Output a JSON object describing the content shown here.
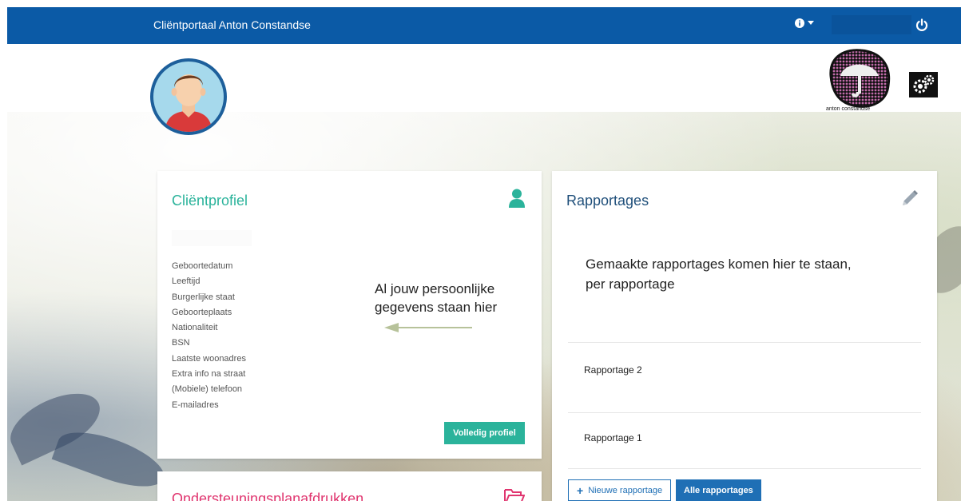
{
  "navbar": {
    "title": "Cliëntportaal Anton Constandse",
    "info_icon": "info-icon",
    "power_icon": "power-icon"
  },
  "header": {
    "logo_text": "anton constandse"
  },
  "profile_panel": {
    "title": "Cliëntprofiel",
    "icon": "user-icon",
    "fields": [
      "Geboortedatum",
      "Leeftijd",
      "Burgerlijke staat",
      "Geboorteplaats",
      "Nationaliteit",
      "BSN",
      "Laatste woonadres",
      "Extra info na straat",
      "(Mobiele) telefoon",
      "E-mailadres"
    ],
    "annotation": "Al jouw persoonlijke gegevens staan hier",
    "button_label": "Volledig profiel"
  },
  "reports_panel": {
    "title": "Rapportages",
    "icon": "pencil-icon",
    "annotation": "Gemaakte rapportages komen hier te staan, per rapportage",
    "items": [
      "Rapportage 2",
      "Rapportage 1"
    ],
    "new_button_label": "Nieuwe rapportage",
    "all_button_label": "Alle rapportages"
  },
  "support_panel": {
    "title": "Ondersteuningsplanafdrukken",
    "icon": "folder-icon"
  },
  "colors": {
    "navbar": "#0b5aa6",
    "teal": "#2bb39b",
    "pink": "#e0356f",
    "blue": "#1f6fb5"
  }
}
